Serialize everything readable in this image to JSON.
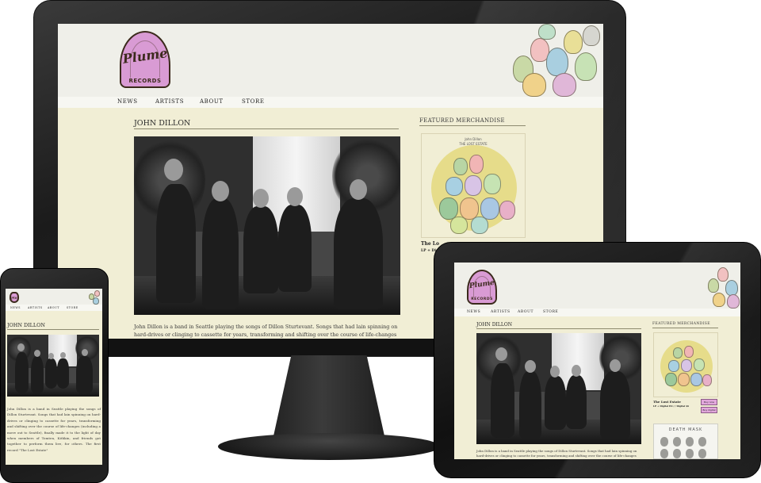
{
  "site": {
    "logo_word": "Plume",
    "logo_sub": "RECORDS",
    "nav": [
      "NEWS",
      "ARTISTS",
      "ABOUT",
      "STORE"
    ],
    "artist_title": "JOHN DILLON",
    "featured_title": "FEATURED MERCHANDISE",
    "body_desktop": "John Dillon is a band in Seattle playing the songs of Dillon Sturtevant. Songs that had lain spinning on hard-drives or clinging to cassette for years, transforming and shifting over the course of life-changes (including a move out to Seattle).",
    "body_tablet": "John Dillon is a band in Seattle playing the songs of Dillon Sturtevant. Songs that had lain spinning on hard-drives or clinging to cassette for years, transforming and shifting over the course of life-changes (including a move out to Seattle).",
    "body_phone": "John Dillon is a band in Seattle playing the songs of Dillon Sturtevant. Songs that had lain spinning on hard-drives or clinging to cassette for years, transforming and shifting over the course of life-changes (including a move out to Seattle), finally made it to the light of day when members of Tomten, Kithkin, and friends got together to perform them live, for others. The first record \"The Lost Estate\"",
    "album": {
      "artist": "John Dillon",
      "title": "THE LOST ESTATE",
      "name_desktop": "The Lo",
      "format_desktop": "LP + Digi",
      "name_tablet": "The Lost Estate",
      "format_tablet": "LP + Digital EO / / Digital $6"
    },
    "buttons": [
      "Buy now",
      "Buy digital"
    ],
    "second_merch": "DEATH MASK"
  },
  "colors": {
    "page_bg": "#f1eed5",
    "header_bg": "#efefe9",
    "logo_fill": "#d99bd4",
    "logo_ink": "#3b2a1c",
    "rule": "#8d8a6f",
    "button": "#e2a7dc"
  }
}
